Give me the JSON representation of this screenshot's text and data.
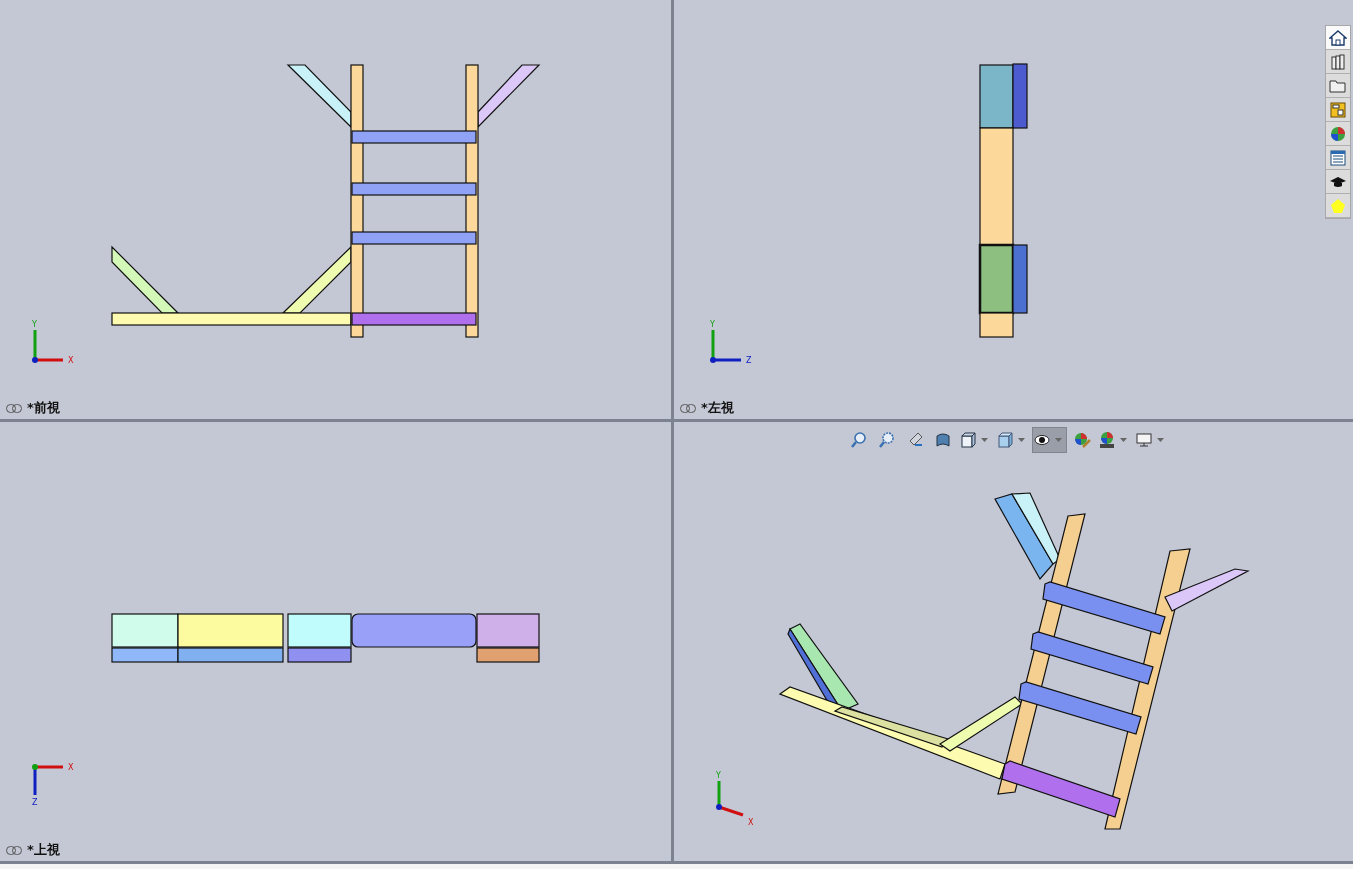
{
  "viewports": [
    {
      "kind": "front",
      "label": "*前視",
      "axes": [
        "Y",
        "X"
      ]
    },
    {
      "kind": "left",
      "label": "*左視",
      "axes": [
        "Y",
        "Z"
      ]
    },
    {
      "kind": "top",
      "label": "*上視",
      "axes": [
        "X",
        "Z"
      ]
    },
    {
      "kind": "iso",
      "axes": [
        "Y",
        "X"
      ]
    }
  ],
  "view_toolbar": [
    {
      "kind": "zoom-fit",
      "selected": false,
      "menu": false
    },
    {
      "kind": "zoom-area",
      "selected": false,
      "menu": false
    },
    {
      "kind": "previous",
      "selected": false,
      "menu": false
    },
    {
      "kind": "section",
      "selected": false,
      "menu": false
    },
    {
      "kind": "orientation",
      "selected": false,
      "menu": true
    },
    {
      "kind": "display",
      "selected": false,
      "menu": true
    },
    {
      "kind": "hide-show",
      "selected": true,
      "menu": true
    },
    {
      "kind": "edit-appearance",
      "selected": false,
      "menu": false
    },
    {
      "kind": "scene",
      "selected": false,
      "menu": true
    },
    {
      "kind": "view-settings",
      "selected": false,
      "menu": true
    }
  ],
  "task_pane": [
    {
      "kind": "home",
      "selected": true
    },
    {
      "kind": "library",
      "selected": false
    },
    {
      "kind": "explorer",
      "selected": false
    },
    {
      "kind": "palette",
      "selected": false
    },
    {
      "kind": "appearance",
      "selected": false
    },
    {
      "kind": "properties",
      "selected": false
    },
    {
      "kind": "learn",
      "selected": false
    },
    {
      "kind": "favorite",
      "selected": false
    }
  ]
}
